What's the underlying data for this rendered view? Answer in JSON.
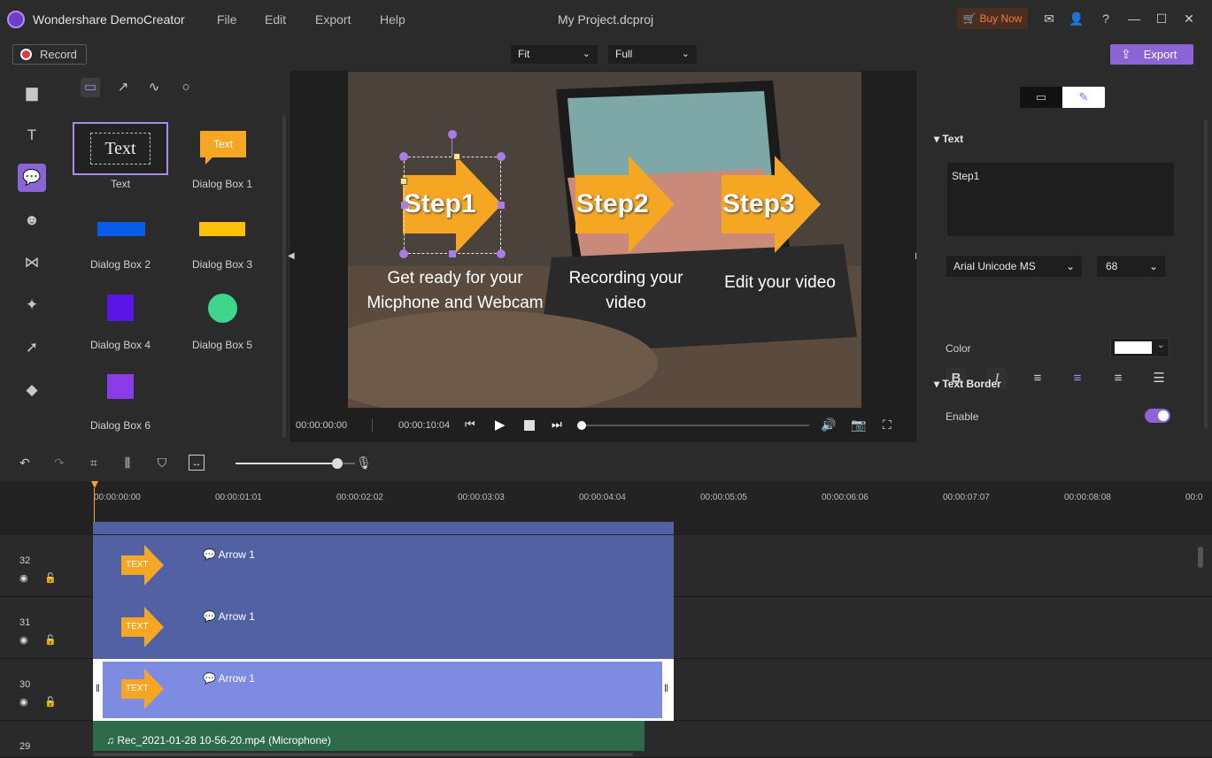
{
  "app": {
    "name": "Wondershare DemoCreator",
    "project_title": "My Project.dcproj",
    "menu": [
      "File",
      "Edit",
      "Export",
      "Help"
    ],
    "buy_now": "Buy Now",
    "record_label": "Record",
    "export_label": "Export",
    "fit_select": "Fit",
    "quality_select": "Full"
  },
  "colors": {
    "accent": "#8b64d6",
    "buy_now": "#f07b3f",
    "arrow": "#f5a623",
    "clip_blue": "#5261a3",
    "clip_selected": "#7d8ce0",
    "audio_clip": "#2e6b4a"
  },
  "library": {
    "tabs": [
      "callout-icon",
      "arrow-icon",
      "sketch-icon",
      "circle-icon"
    ],
    "rail_icons": [
      "folder-icon",
      "text-icon",
      "annotation-icon",
      "sticker-icon",
      "transition-icon",
      "effects-icon",
      "cursor-icon",
      "eraser-icon"
    ],
    "items": [
      {
        "label": "Text",
        "preview_text": "Text"
      },
      {
        "label": "Dialog Box 1",
        "preview_text": "Text"
      },
      {
        "label": "Dialog Box 2"
      },
      {
        "label": "Dialog Box 3"
      },
      {
        "label": "Dialog Box 4"
      },
      {
        "label": "Dialog Box 5"
      },
      {
        "label": "Dialog Box 6"
      }
    ]
  },
  "canvas": {
    "steps": [
      "Step1",
      "Step2",
      "Step3"
    ],
    "captions": [
      [
        "Get ready for your",
        "Micphone and Webcam"
      ],
      [
        "Recording your",
        "video"
      ],
      [
        "Edit your video"
      ]
    ]
  },
  "player": {
    "current_time": "00:00:00:00",
    "total_time": "00:00:10:04",
    "progress": 0
  },
  "properties": {
    "tabs": [
      "camera-icon",
      "edit-icon"
    ],
    "text_section": "Text",
    "text_value": "Step1",
    "font": "Arial Unicode MS",
    "font_size": "68",
    "color_label": "Color",
    "border_section": "Text Border",
    "enable_label": "Enable",
    "enable_on": true
  },
  "timeline": {
    "ticks": [
      "00:00:00:00",
      "00:00:01:01",
      "00:00:02:02",
      "00:00:03:03",
      "00:00:04:04",
      "00:00:05:05",
      "00:00:06:06",
      "00:00:07:07",
      "00:00:08:08",
      "00:0"
    ],
    "tracks": [
      {
        "number": "32",
        "clip": "Arrow 1",
        "thumb": "TEXT"
      },
      {
        "number": "31",
        "clip": "Arrow 1",
        "thumb": "TEXT"
      },
      {
        "number": "30",
        "clip": "Arrow 1",
        "thumb": "TEXT"
      },
      {
        "number": "29",
        "clip": "Rec_2021-01-28 10-56-20.mp4 (Microphone)"
      }
    ],
    "zoom_level": 0.85
  }
}
